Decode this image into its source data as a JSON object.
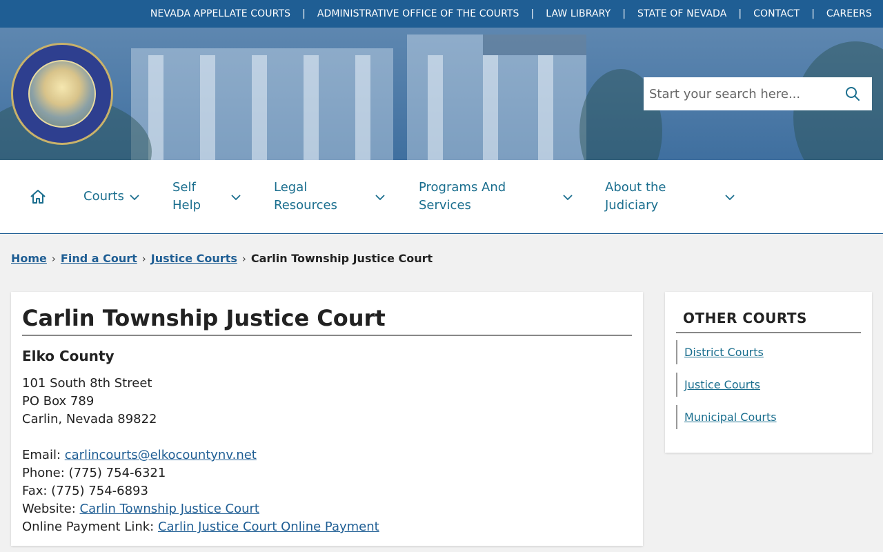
{
  "topbar": {
    "links": [
      "NEVADA APPELLATE COURTS",
      "ADMINISTRATIVE OFFICE OF THE COURTS",
      "LAW LIBRARY",
      "STATE OF NEVADA",
      "CONTACT",
      "CAREERS"
    ],
    "separator": "|"
  },
  "search": {
    "placeholder": "Start your search here..."
  },
  "nav": {
    "courts": "Courts",
    "self_help_1": "Self",
    "self_help_2": "Help",
    "legal_1": "Legal",
    "legal_2": "Resources",
    "programs_1": "Programs And",
    "programs_2": "Services",
    "about_1": "About the",
    "about_2": "Judiciary"
  },
  "breadcrumb": {
    "home": "Home",
    "find": "Find a Court",
    "justice": "Justice Courts",
    "current": "Carlin Township Justice Court",
    "sep": "›"
  },
  "main": {
    "title": "Carlin Township Justice Court",
    "county": "Elko County",
    "address_1": "101 South 8th Street",
    "address_2": "PO Box 789",
    "address_3": "Carlin, Nevada 89822",
    "email_label": "Email: ",
    "email": "carlincourts@elkocountynv.net",
    "phone": "Phone: (775) 754-6321",
    "fax": "Fax: (775) 754-6893",
    "website_label": "Website: ",
    "website": "Carlin Township Justice Court",
    "payment_label": "Online Payment Link: ",
    "payment": "Carlin Justice Court Online Payment"
  },
  "sidebar": {
    "title": "OTHER COURTS",
    "items": [
      "District Courts",
      "Justice Courts",
      "Municipal Courts"
    ]
  },
  "colors": {
    "brand_blue": "#1f5e94",
    "nav_teal": "#1a6e8e"
  }
}
